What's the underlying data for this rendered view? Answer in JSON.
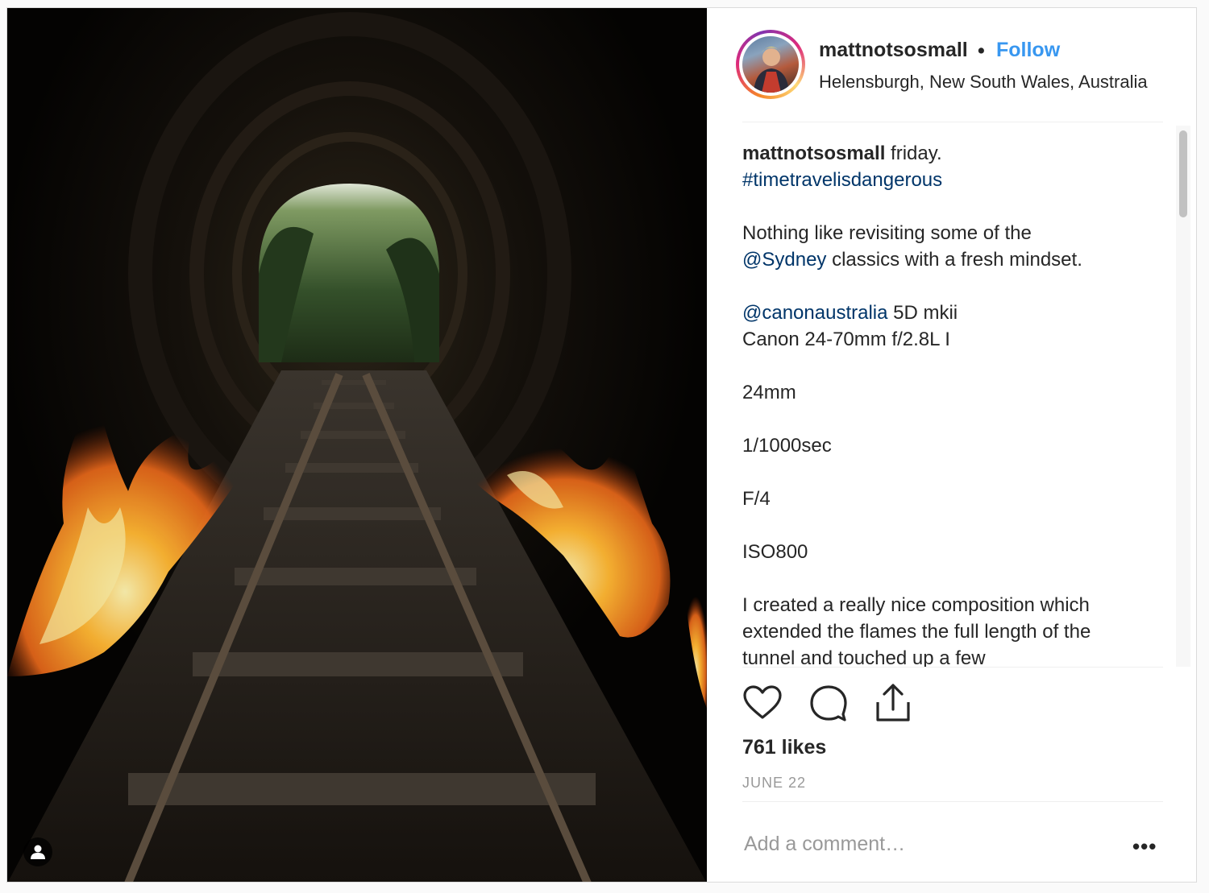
{
  "post": {
    "username": "mattnotsosmall",
    "separator": "•",
    "follow_label": "Follow",
    "location": "Helensburgh, New South Wales, Australia",
    "caption": {
      "username": "mattnotsosmall",
      "first_line": " friday.",
      "hashtag": "#timetravelisdangerous",
      "line_a1": "Nothing like revisiting some of the",
      "mention_sydney": "@Sydney",
      "line_a2": " classics with a fresh mindset.",
      "mention_canon": "@canonaustralia",
      "camera": " 5D mkii",
      "lens": "Canon 24-70mm f/2.8L I",
      "focal": "24mm",
      "shutter": "1/1000sec",
      "aperture": "F/4",
      "iso": "ISO800",
      "body_1": "I created a really nice composition which",
      "body_2": "extended the flames the full length of the",
      "body_3": "tunnel and touched up a few"
    },
    "likes": "761 likes",
    "date": "JUNE 22",
    "comment_placeholder": "Add a comment…",
    "more_label": "•••"
  },
  "icons": {
    "like": "heart-icon",
    "comment": "comment-bubble-icon",
    "share": "share-upload-icon",
    "tagged_user": "user-silhouette-icon"
  },
  "colors": {
    "link": "#003569",
    "follow": "#3897f0",
    "text": "#262626",
    "muted": "#999999"
  }
}
